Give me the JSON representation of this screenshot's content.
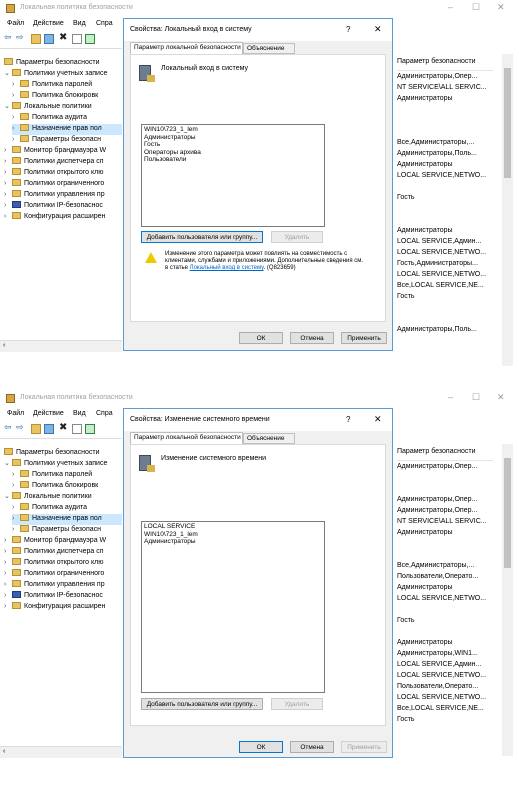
{
  "window": {
    "title": "Локальная политика безопасности"
  },
  "menu": [
    "Файл",
    "Действие",
    "Вид",
    "Спра"
  ],
  "tree": {
    "items": [
      {
        "label": "Параметры безопасности",
        "indent": 0,
        "arrow": ""
      },
      {
        "label": "Политики учетных записе",
        "indent": 1,
        "arrow": "v"
      },
      {
        "label": "Политика паролей",
        "indent": 2,
        "arrow": ">"
      },
      {
        "label": "Политика блокировк",
        "indent": 2,
        "arrow": ">"
      },
      {
        "label": "Локальные политики",
        "indent": 1,
        "arrow": "v"
      },
      {
        "label": "Политика аудита",
        "indent": 2,
        "arrow": ">"
      },
      {
        "label": "Назначение прав пол",
        "indent": 2,
        "arrow": ">",
        "selected": true
      },
      {
        "label": "Параметры безопасн",
        "indent": 2,
        "arrow": ">"
      },
      {
        "label": "Монитор брандмауэра W",
        "indent": 1,
        "arrow": ">"
      },
      {
        "label": "Политики диспетчера сп",
        "indent": 1,
        "arrow": ">"
      },
      {
        "label": "Политики открытого клю",
        "indent": 1,
        "arrow": ">"
      },
      {
        "label": "Политики ограниченного",
        "indent": 1,
        "arrow": ">"
      },
      {
        "label": "Политики управления пр",
        "indent": 1,
        "arrow": ">"
      },
      {
        "label": "Политики IP-безопаснос",
        "indent": 1,
        "arrow": ">"
      },
      {
        "label": "Конфигурация расширен",
        "indent": 1,
        "arrow": ">"
      }
    ]
  },
  "right_header": "Параметр безопасности",
  "dialogs": [
    {
      "title": "Свойства: Локальный вход в систему",
      "help": "?",
      "close": "✕",
      "tab_active": "Параметр локальной безопасности",
      "tab_other": "Объяснение",
      "policy_name": "Локальный вход в систему",
      "members": [
        "WIN10\\723_1_lem",
        "Администраторы",
        "Гость",
        "Операторы архива",
        "Пользователи"
      ],
      "add_button": "Добавить пользователя или группу...",
      "remove_button": "Удалить",
      "warning_text": "Изменение этого параметра может повлиять на совместимость с клиентами, службами и приложениями. Дополнительные сведения см. в статье ",
      "warning_link": "Локальный вход в систему",
      "warning_tail": ". (Q823659)",
      "ok": "ОК",
      "cancel": "Отмена",
      "apply": "Применить",
      "right_items": [
        "Администраторы,Опер...",
        "NT SERVICE\\ALL SERVIC...",
        "Администраторы",
        "",
        "",
        "",
        "Все,Администраторы,...",
        "Администраторы,Поль...",
        "Администраторы",
        "LOCAL SERVICE,NETWO...",
        "",
        "Гость",
        "",
        "",
        "Администраторы",
        "LOCAL SERVICE,Админ...",
        "LOCAL SERVICE,NETWO...",
        "Гость,Администраторы...",
        "LOCAL SERVICE,NETWO...",
        "Все,LOCAL SERVICE,NE...",
        "Гость",
        "",
        "",
        "Администраторы,Поль..."
      ]
    },
    {
      "title": "Свойства: Изменение системного времени",
      "help": "?",
      "close": "✕",
      "tab_active": "Параметр локальной безопасности",
      "tab_other": "Объяснение",
      "policy_name": "Изменение системного времени",
      "members": [
        "LOCAL SERVICE",
        "WIN10\\723_1_lem",
        "Администраторы"
      ],
      "add_button": "Добавить пользователя или группу...",
      "remove_button": "Удалить",
      "ok": "ОК",
      "cancel": "Отмена",
      "apply": "Применить",
      "right_items": [
        "Администраторы,Опер...",
        "",
        "",
        "Администраторы,Опер...",
        "Администраторы,Опер...",
        "NT SERVICE\\ALL SERVIC...",
        "Администраторы",
        "",
        "",
        "Все,Администраторы,...",
        "Пользователи,Операто...",
        "Администраторы",
        "LOCAL SERVICE,NETWO...",
        "",
        "Гость",
        "",
        "Администраторы",
        "Администраторы,WIN1...",
        "LOCAL SERVICE,Админ...",
        "LOCAL SERVICE,NETWO...",
        "Пользователи,Операто...",
        "LOCAL SERVICE,NETWO...",
        "Все,LOCAL SERVICE,NE...",
        "Гость"
      ]
    }
  ]
}
